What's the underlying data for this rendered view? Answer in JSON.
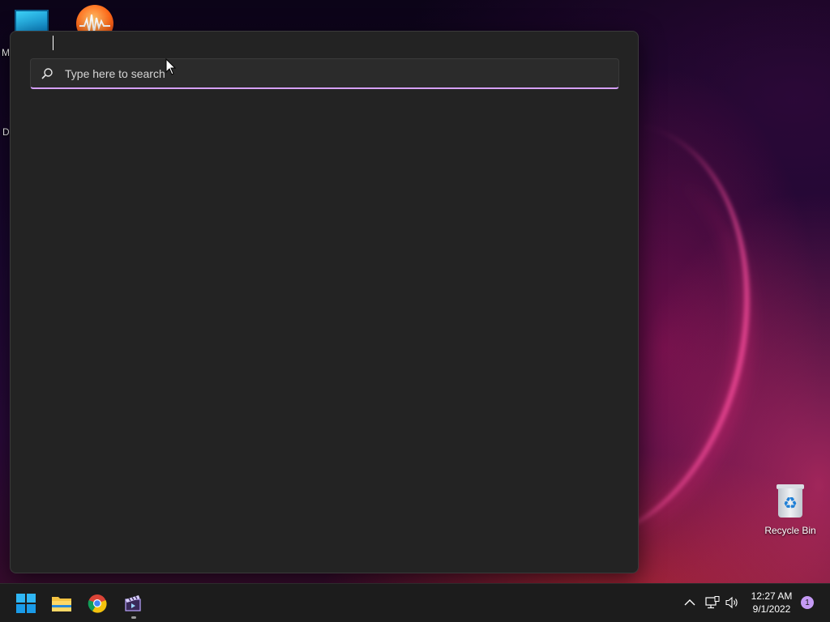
{
  "desktop": {
    "left_edge_letters": [
      "M",
      "Da"
    ],
    "recycle_bin": {
      "label": "Recycle Bin",
      "icon": "recycle-bin-icon"
    }
  },
  "search": {
    "placeholder": "Type here to search",
    "value": "",
    "accent_color": "#d7a0ff",
    "icon": "search-icon"
  },
  "taskbar": {
    "apps": [
      {
        "name": "Start",
        "icon": "windows-start-icon"
      },
      {
        "name": "File Explorer",
        "icon": "folder-icon"
      },
      {
        "name": "Google Chrome",
        "icon": "chrome-icon"
      },
      {
        "name": "Video Editor",
        "icon": "video-clapper-icon"
      }
    ],
    "tray": {
      "icons": [
        "chevron-up-icon",
        "network-icon",
        "volume-icon"
      ],
      "time": "12:27 AM",
      "date": "9/1/2022",
      "notification_count": "1"
    }
  }
}
